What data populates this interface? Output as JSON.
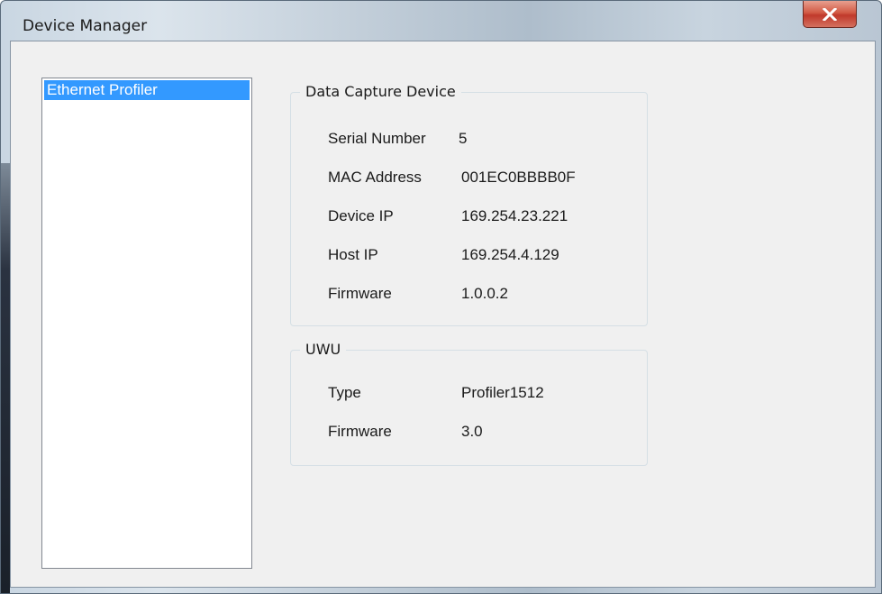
{
  "window": {
    "title": "Device Manager",
    "close_glyph": "X"
  },
  "device_list": {
    "items": [
      {
        "label": "Ethernet Profiler",
        "selected": true
      }
    ],
    "selection_color": "#3399ff"
  },
  "data_capture_device": {
    "title": "Data Capture Device",
    "rows": [
      {
        "label": "Serial Number",
        "value": "5"
      },
      {
        "label": "MAC Address",
        "value": "001EC0BBBB0F"
      },
      {
        "label": "Device IP",
        "value": "169.254.23.221"
      },
      {
        "label": "Host IP",
        "value": "169.254.4.129"
      },
      {
        "label": "Firmware",
        "value": "1.0.0.2"
      }
    ]
  },
  "uwu": {
    "title": "UWU",
    "rows": [
      {
        "label": "Type",
        "value": "Profiler1512"
      },
      {
        "label": "Firmware",
        "value": "3.0"
      }
    ]
  },
  "icons": {
    "close": "close-icon"
  },
  "colors": {
    "close_button": "#c0392b",
    "dialog_background": "#f0f0f0"
  }
}
